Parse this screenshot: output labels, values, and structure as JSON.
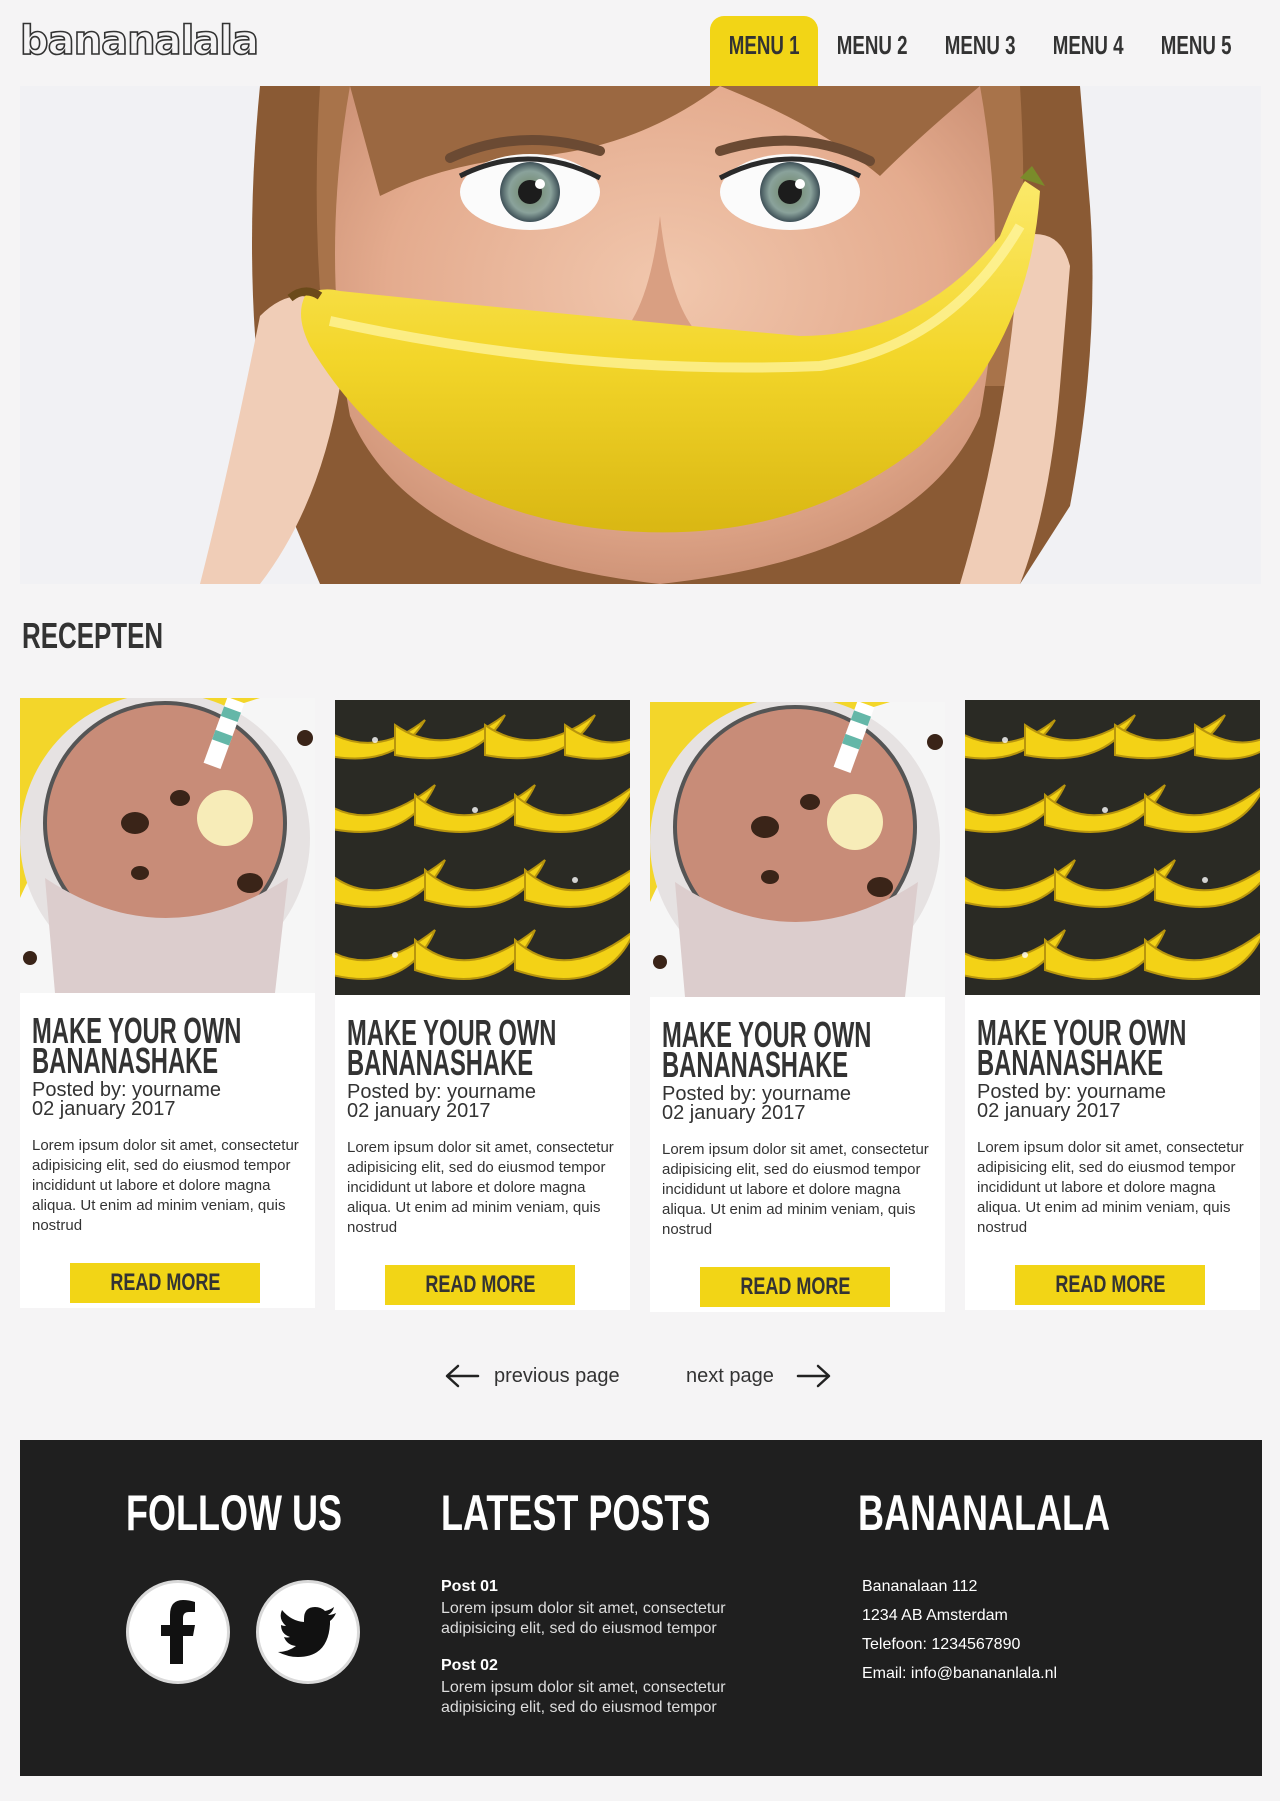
{
  "header": {
    "logo": "bananalala",
    "nav": [
      {
        "label": "MENU 1",
        "active": true
      },
      {
        "label": "MENU 2",
        "active": false
      },
      {
        "label": "MENU 3",
        "active": false
      },
      {
        "label": "MENU 4",
        "active": false
      },
      {
        "label": "MENU 5",
        "active": false
      }
    ]
  },
  "colors": {
    "accent": "#f2d516",
    "footer_bg": "#1f1f1f",
    "page_bg": "#f5f4f5",
    "text": "#333333"
  },
  "section": {
    "title": "RECEPTEN"
  },
  "cards": [
    {
      "image": "chocolate-banana-shake-photo",
      "title_line1": "MAKE YOUR OWN",
      "title_line2": "BANANASHAKE",
      "posted_by": "Posted by: yourname",
      "date": "02 january 2017",
      "text": "Lorem ipsum dolor sit amet, consectetur adipisicing elit, sed do eiusmod tempor incididunt ut labore et dolore magna aliqua. Ut enim ad minim veniam, quis nostrud",
      "button": "READ MORE"
    },
    {
      "image": "banana-bunches-photo",
      "title_line1": "MAKE YOUR OWN",
      "title_line2": "BANANASHAKE",
      "posted_by": "Posted by: yourname",
      "date": "02 january 2017",
      "text": "Lorem ipsum dolor sit amet, consectetur adipisicing elit, sed do eiusmod tempor incididunt ut labore et dolore magna aliqua. Ut enim ad minim veniam, quis nostrud",
      "button": "READ MORE"
    },
    {
      "image": "chocolate-banana-shake-photo",
      "title_line1": "MAKE YOUR OWN",
      "title_line2": "BANANASHAKE",
      "posted_by": "Posted by: yourname",
      "date": "02 january 2017",
      "text": "Lorem ipsum dolor sit amet, consectetur adipisicing elit, sed do eiusmod tempor incididunt ut labore et dolore magna aliqua. Ut enim ad minim veniam, quis nostrud",
      "button": "READ MORE"
    },
    {
      "image": "banana-bunches-photo",
      "title_line1": "MAKE YOUR OWN",
      "title_line2": "BANANASHAKE",
      "posted_by": "Posted by: yourname",
      "date": "02 january 2017",
      "text": "Lorem ipsum dolor sit amet, consectetur adipisicing elit, sed do eiusmod tempor incididunt ut labore et dolore magna aliqua. Ut enim ad minim veniam, quis nostrud",
      "button": "READ MORE"
    }
  ],
  "pagination": {
    "previous": "previous page",
    "next": "next page",
    "previous_icon": "arrow-left-icon",
    "next_icon": "arrow-right-icon"
  },
  "footer": {
    "follow": {
      "heading": "FOLLOW US",
      "icons": [
        "facebook-icon",
        "twitter-icon"
      ]
    },
    "latest": {
      "heading": "LATEST POSTS",
      "posts": [
        {
          "title": "Post 01",
          "body": "Lorem ipsum dolor sit amet, consectetur adipisicing elit, sed do eiusmod tempor"
        },
        {
          "title": "Post 02",
          "body": "Lorem ipsum dolor sit amet, consectetur adipisicing elit, sed do eiusmod tempor"
        }
      ]
    },
    "contact": {
      "heading": "BANANALALA",
      "address": "Bananalaan 112",
      "city": "1234 AB Amsterdam",
      "phone": "Telefoon: 1234567890",
      "email": "Email: info@banananlala.nl"
    }
  }
}
